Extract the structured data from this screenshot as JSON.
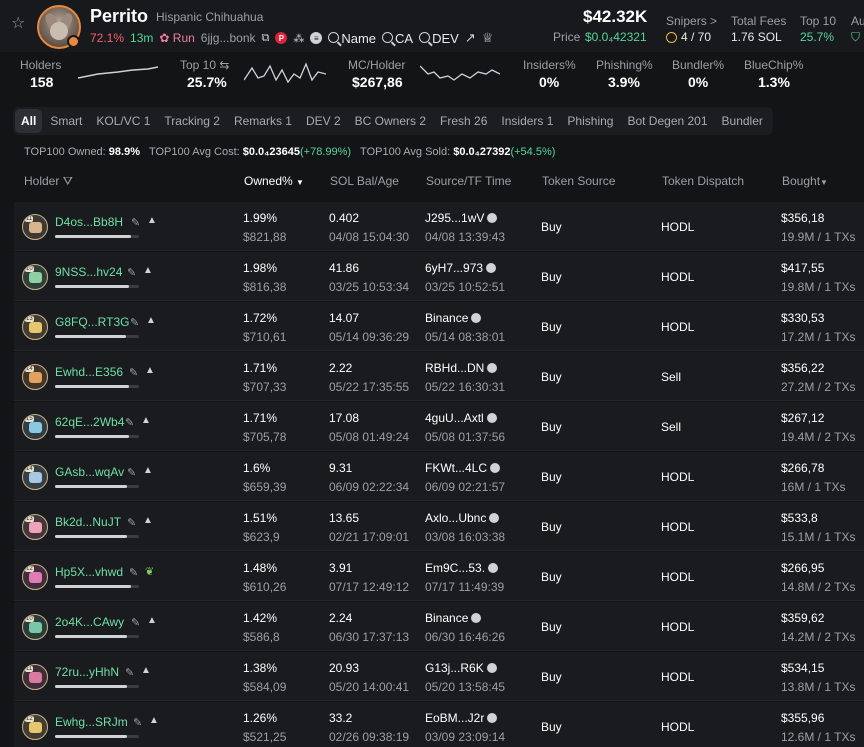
{
  "token": {
    "name": "Perrito",
    "full_name": "Hispanic Chihuahua",
    "change_pct": "72.1%",
    "age": "13m",
    "run_label": "Run",
    "address": "6jjg...bonk",
    "search_name": "Name",
    "search_ca": "CA",
    "search_dev": "DEV"
  },
  "market": {
    "mcap": "$42.32K",
    "price_label": "Price",
    "price_value": "$0.0₄42321"
  },
  "stats": {
    "snipers_label": "Snipers >",
    "snipers_value": "4 / 70",
    "fees_label": "Total Fees",
    "fees_value": "1.76 SOL",
    "top10_label": "Top 10",
    "top10_value": "25.7%",
    "cut_label": "Au"
  },
  "metrics": {
    "holders_label": "Holders",
    "holders_value": "158",
    "top10_label": "Top 10",
    "top10_value": "25.7%",
    "mc_holder_label": "MC/Holder",
    "mc_holder_value": "$267,86",
    "insiders_label": "Insiders%",
    "insiders_value": "0%",
    "phishing_label": "Phishing%",
    "phishing_value": "3.9%",
    "bundler_label": "Bundler%",
    "bundler_value": "0%",
    "bluechip_label": "BlueChip%",
    "bluechip_value": "1.3%"
  },
  "tabs": [
    "All",
    "Smart",
    "KOL/VC 1",
    "Tracking 2",
    "Remarks 1",
    "DEV 2",
    "BC Owners 2",
    "Fresh 26",
    "Insiders 1",
    "Phishing",
    "Bot Degen 201",
    "Bundler"
  ],
  "summary": {
    "owned_label": "TOP100 Owned:",
    "owned_value": "98.9%",
    "avg_cost_label": "TOP100 Avg Cost:",
    "avg_cost_value": "$0.0₄23645",
    "avg_cost_change": "(+78.99%)",
    "avg_sold_label": "TOP100 Avg Sold:",
    "avg_sold_value": "$0.0₄27392",
    "avg_sold_change": "(+54.5%)"
  },
  "columns": {
    "holder": "Holder",
    "owned": "Owned%",
    "sol": "SOL Bal/Age",
    "source": "Source/TF Time",
    "token_source": "Token Source",
    "token_dispatch": "Token Dispatch",
    "bought": "Bought"
  },
  "rows": [
    {
      "holder": "D4os...Bb8H",
      "bar": 0.9,
      "owned": "1.99%",
      "owned_usd": "$821,88",
      "sol": "0.402",
      "age": "04/08 15:04:30",
      "src": "J295...1wV",
      "src_time": "04/08 13:39:43",
      "tsrc": "Buy",
      "tdis": "HODL",
      "bought": "$356,18",
      "bought_sub": "19.9M / 1 TXs",
      "lvl": "11",
      "color": "#d9b48a"
    },
    {
      "holder": "9NSS...hv24",
      "bar": 0.88,
      "owned": "1.98%",
      "owned_usd": "$816,38",
      "sol": "41.86",
      "age": "03/25 10:53:34",
      "src": "6yH7...973",
      "src_time": "03/25 10:52:51",
      "tsrc": "Buy",
      "tdis": "HODL",
      "bought": "$417,55",
      "bought_sub": "19.8M / 1 TXs",
      "lvl": "10",
      "color": "#8fd1a4"
    },
    {
      "holder": "G8FQ...RT3G",
      "bar": 0.85,
      "owned": "1.72%",
      "owned_usd": "$710,61",
      "sol": "14.07",
      "age": "05/14 09:36:29",
      "src": "Binance",
      "src_time": "05/14 08:38:01",
      "tsrc": "Buy",
      "tdis": "HODL",
      "bought": "$330,53",
      "bought_sub": "17.2M / 1 TXs",
      "lvl": "13",
      "color": "#e6c76f"
    },
    {
      "holder": "Ewhd...E356",
      "bar": 0.88,
      "owned": "1.71%",
      "owned_usd": "$707,33",
      "sol": "2.22",
      "age": "05/22 17:35:55",
      "src": "RBHd...DN",
      "src_time": "05/22 16:30:31",
      "tsrc": "Buy",
      "tdis": "Sell",
      "bought": "$356,22",
      "bought_sub": "27.2M / 2 TXs",
      "lvl": "14",
      "color": "#e2a15c"
    },
    {
      "holder": "62qE...2Wb4",
      "bar": 0.88,
      "owned": "1.71%",
      "owned_usd": "$705,78",
      "sol": "17.08",
      "age": "05/08 01:49:24",
      "src": "4guU...Axtl",
      "src_time": "05/08 01:37:56",
      "tsrc": "Buy",
      "tdis": "Sell",
      "bought": "$267,12",
      "bought_sub": "19.4M / 2 TXs",
      "lvl": "15",
      "color": "#8ac9e0"
    },
    {
      "holder": "GAsb...wqAv",
      "bar": 0.86,
      "owned": "1.6%",
      "owned_usd": "$659,39",
      "sol": "9.31",
      "age": "06/09 02:22:34",
      "src": "FKWt...4LC",
      "src_time": "06/09 02:21:57",
      "tsrc": "Buy",
      "tdis": "HODL",
      "bought": "$266,78",
      "bought_sub": "16M / 1 TXs",
      "lvl": "14",
      "color": "#a7c7e3"
    },
    {
      "holder": "Bk2d...NuJT",
      "bar": 0.86,
      "owned": "1.51%",
      "owned_usd": "$623,9",
      "sol": "13.65",
      "age": "02/21 17:09:01",
      "src": "Axlo...Ubnc",
      "src_time": "03/08 16:03:38",
      "tsrc": "Buy",
      "tdis": "HODL",
      "bought": "$533,8",
      "bought_sub": "15.1M / 1 TXs",
      "lvl": "13",
      "color": "#f0a3b8"
    },
    {
      "holder": "Hp5X...vhwd",
      "bar": 0.9,
      "owned": "1.48%",
      "owned_usd": "$610,26",
      "sol": "3.91",
      "age": "07/17 12:49:12",
      "src": "Em9C...53.",
      "src_time": "07/17 11:49:39",
      "tsrc": "Buy",
      "tdis": "HODL",
      "bought": "$266,95",
      "bought_sub": "14.8M / 2 TXs",
      "lvl": "12",
      "color": "#e07bb3"
    },
    {
      "holder": "2o4K...CAwy",
      "bar": 0.86,
      "owned": "1.42%",
      "owned_usd": "$586,8",
      "sol": "2.24",
      "age": "06/30 17:37:13",
      "src": "Binance",
      "src_time": "06/30 16:46:26",
      "tsrc": "Buy",
      "tdis": "HODL",
      "bought": "$359,62",
      "bought_sub": "14.2M / 2 TXs",
      "lvl": "10",
      "color": "#79c7a7"
    },
    {
      "holder": "72ru...yHhN",
      "bar": 0.86,
      "owned": "1.38%",
      "owned_usd": "$584,09",
      "sol": "20.93",
      "age": "05/20 14:00:41",
      "src": "G13j...R6K",
      "src_time": "05/20 13:58:45",
      "tsrc": "Buy",
      "tdis": "HODL",
      "bought": "$534,15",
      "bought_sub": "13.8M / 1 TXs",
      "lvl": "11",
      "color": "#d97aa0"
    },
    {
      "holder": "Ewhg...SRJm",
      "bar": 0.86,
      "owned": "1.26%",
      "owned_usd": "$521,25",
      "sol": "33.2",
      "age": "02/26 09:38:19",
      "src": "EoBM...J2r",
      "src_time": "03/09 23:09:14",
      "tsrc": "Buy",
      "tdis": "HODL",
      "bought": "$355,96",
      "bought_sub": "12.6M / 1 TXs",
      "lvl": "12",
      "color": "#e6c76f"
    }
  ],
  "colors": {
    "accent_green": "#55d69b",
    "accent_red": "#f0616d",
    "holder_green": "#6ee0a5",
    "background": "#131416"
  }
}
